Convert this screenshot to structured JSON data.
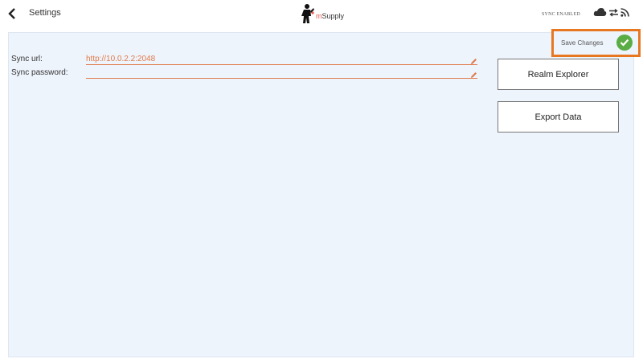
{
  "header": {
    "title": "Settings",
    "logo_text": "mSupply",
    "sync_status": "SYNC ENABLED"
  },
  "fields": [
    {
      "label": "Sync url:",
      "value": "http://10.0.2.2:2048"
    },
    {
      "label": "Sync password:",
      "value": ""
    }
  ],
  "buttons": {
    "realm_explorer": "Realm Explorer",
    "export_data": "Export Data",
    "save_changes": "Save Changes"
  },
  "colors": {
    "accent": "#e07a4a",
    "highlight": "#e87722",
    "check": "#5aac44",
    "panel": "#eef4fc"
  }
}
